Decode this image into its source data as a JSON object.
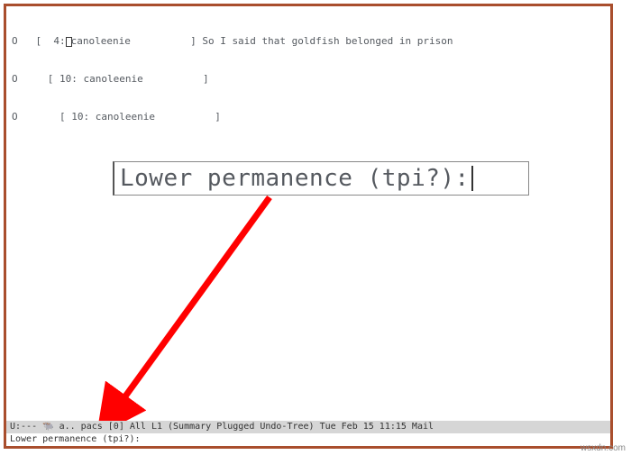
{
  "threads": {
    "row1": {
      "flag": "O",
      "indent": "   ",
      "open": "[",
      "count": "  4:",
      "user": "canoleenie          ",
      "close": "]",
      "subject": " So I said that goldfish belonged in prison"
    },
    "row2": {
      "flag": "O",
      "indent": "     ",
      "open": "[",
      "count": " 10:",
      "user": " canoleenie          ",
      "close": "]",
      "subject": ""
    },
    "row3": {
      "flag": "O",
      "indent": "       ",
      "open": "[",
      "count": " 10:",
      "user": " canoleenie          ",
      "close": "]",
      "subject": ""
    }
  },
  "magnified": {
    "text": "Lower permanence (tpi?): "
  },
  "modeline": {
    "full": "U:---  🐃 a..  pacs [0]    All L1     (Summary Plugged Undo-Tree) Tue Feb 15 11:15 Mail"
  },
  "minibuffer": {
    "prompt": "Lower permanence (tpi?): "
  },
  "watermark": "wsxdn.com"
}
